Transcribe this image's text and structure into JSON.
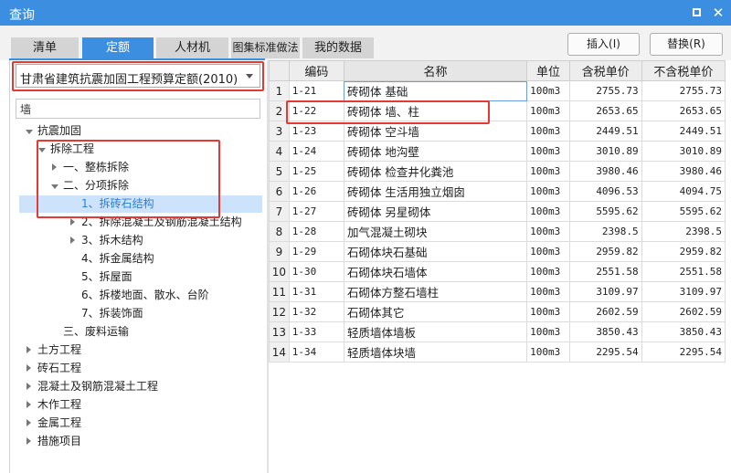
{
  "window": {
    "title": "查询"
  },
  "tabs": [
    {
      "label": "清单",
      "active": false
    },
    {
      "label": "定额",
      "active": true
    },
    {
      "label": "人材机",
      "active": false
    },
    {
      "label": "图集标准做法",
      "active": false
    },
    {
      "label": "我的数据",
      "active": false
    }
  ],
  "actions": {
    "insert_label": "插入(I)",
    "replace_label": "替换(R)"
  },
  "left": {
    "quota_dropdown": "甘肃省建筑抗震加固工程预算定额(2010)",
    "search_value": "墙",
    "tree": [
      {
        "label": "抗震加固",
        "expander": "open",
        "selected": false
      },
      {
        "label": "拆除工程",
        "expander": "open",
        "selected": false
      },
      {
        "label": "一、整栋拆除",
        "expander": "closed",
        "selected": false
      },
      {
        "label": "二、分项拆除",
        "expander": "open",
        "selected": false
      },
      {
        "label": "1、拆砖石结构",
        "expander": "none",
        "selected": true
      },
      {
        "label": "2、拆除混凝土及钢筋混凝土结构",
        "expander": "closed",
        "selected": false
      },
      {
        "label": "3、拆木结构",
        "expander": "closed",
        "selected": false
      },
      {
        "label": "4、拆金属结构",
        "expander": "none",
        "selected": false
      },
      {
        "label": "5、拆屋面",
        "expander": "none",
        "selected": false
      },
      {
        "label": "6、拆楼地面、散水、台阶",
        "expander": "none",
        "selected": false
      },
      {
        "label": "7、拆装饰面",
        "expander": "none",
        "selected": false
      },
      {
        "label": "三、废料运输",
        "expander": "none",
        "selected": false
      },
      {
        "label": "土方工程",
        "expander": "closed",
        "selected": false
      },
      {
        "label": "砖石工程",
        "expander": "closed",
        "selected": false
      },
      {
        "label": "混凝土及钢筋混凝土工程",
        "expander": "closed",
        "selected": false
      },
      {
        "label": "木作工程",
        "expander": "closed",
        "selected": false
      },
      {
        "label": "金属工程",
        "expander": "closed",
        "selected": false
      },
      {
        "label": "措施项目",
        "expander": "closed",
        "selected": false
      }
    ]
  },
  "table": {
    "columns": [
      "编码",
      "名称",
      "单位",
      "含税单价",
      "不含税单价"
    ],
    "rows": [
      {
        "num": "1",
        "code": "1-21",
        "name": "砖砌体 基础",
        "unit": "100m3",
        "price_tax": "2755.73",
        "price_notax": "2755.73"
      },
      {
        "num": "2",
        "code": "1-22",
        "name": "砖砌体 墙、柱",
        "unit": "100m3",
        "price_tax": "2653.65",
        "price_notax": "2653.65"
      },
      {
        "num": "3",
        "code": "1-23",
        "name": "砖砌体 空斗墙",
        "unit": "100m3",
        "price_tax": "2449.51",
        "price_notax": "2449.51"
      },
      {
        "num": "4",
        "code": "1-24",
        "name": "砖砌体 地沟壁",
        "unit": "100m3",
        "price_tax": "3010.89",
        "price_notax": "3010.89"
      },
      {
        "num": "5",
        "code": "1-25",
        "name": "砖砌体 检查井化粪池",
        "unit": "100m3",
        "price_tax": "3980.46",
        "price_notax": "3980.46"
      },
      {
        "num": "6",
        "code": "1-26",
        "name": "砖砌体 生活用独立烟囱",
        "unit": "100m3",
        "price_tax": "4096.53",
        "price_notax": "4094.75"
      },
      {
        "num": "7",
        "code": "1-27",
        "name": "砖砌体 另星砌体",
        "unit": "100m3",
        "price_tax": "5595.62",
        "price_notax": "5595.62"
      },
      {
        "num": "8",
        "code": "1-28",
        "name": "加气混凝土砌块",
        "unit": "100m3",
        "price_tax": "2398.5",
        "price_notax": "2398.5"
      },
      {
        "num": "9",
        "code": "1-29",
        "name": "石砌体块石基础",
        "unit": "100m3",
        "price_tax": "2959.82",
        "price_notax": "2959.82"
      },
      {
        "num": "10",
        "code": "1-30",
        "name": "石砌体块石墙体",
        "unit": "100m3",
        "price_tax": "2551.58",
        "price_notax": "2551.58"
      },
      {
        "num": "11",
        "code": "1-31",
        "name": "石砌体方整石墙柱",
        "unit": "100m3",
        "price_tax": "3109.97",
        "price_notax": "3109.97"
      },
      {
        "num": "12",
        "code": "1-32",
        "name": "石砌体其它",
        "unit": "100m3",
        "price_tax": "2602.59",
        "price_notax": "2602.59"
      },
      {
        "num": "13",
        "code": "1-33",
        "name": "轻质墙体墙板",
        "unit": "100m3",
        "price_tax": "3850.43",
        "price_notax": "3850.43"
      },
      {
        "num": "14",
        "code": "1-34",
        "name": "轻质墙体块墙",
        "unit": "100m3",
        "price_tax": "2295.54",
        "price_notax": "2295.54"
      }
    ]
  },
  "colors": {
    "accent": "#3c8fe0",
    "highlight": "#e53935",
    "selection": "#cde3fb"
  },
  "icons": {
    "maximize": "maximize-icon",
    "close": "close-icon",
    "dropdown": "chevron-down-icon",
    "expand": "triangle-expander-icon"
  }
}
